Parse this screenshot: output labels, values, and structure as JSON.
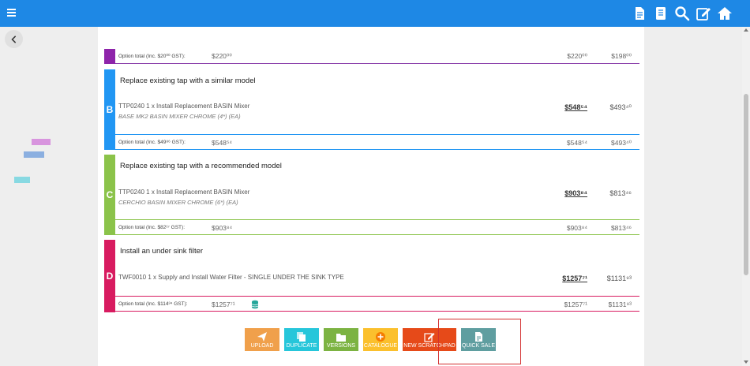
{
  "colors": {
    "topbar": "#1e88e5",
    "option_b": "#2196f3",
    "option_c": "#8bc34a",
    "option_d": "#d81b60",
    "option_prev": "#8e24aa",
    "highlight": "#d32f2f"
  },
  "topbar": {
    "icons": [
      "menu-icon",
      "document-icon",
      "notes-icon",
      "search-icon",
      "edit-icon",
      "home-icon"
    ]
  },
  "partial_row": {
    "label": "Option total (Inc. $20⁰⁰ GST):",
    "value": "$220⁰⁰",
    "price": "$220⁰⁰",
    "alt": "$198⁰⁰"
  },
  "options": [
    {
      "letter": "B",
      "title": "Replace existing tap with a similar model",
      "code": "TTP0240",
      "qty": "1",
      "desc": "x Install Replacement BASIN Mixer",
      "sub": "BASE MK2 BASIN MIXER CHROME (4*) (EA)",
      "price": "$548⁵⁴",
      "alt": "$493⁴⁰",
      "total_label": "Option total (Inc. $49⁸⁶ GST):",
      "total": "$548⁵⁴",
      "total_r1": "$548⁵⁴",
      "total_r2": "$493⁴⁰"
    },
    {
      "letter": "C",
      "title": "Replace existing tap with a recommended model",
      "code": "TTP0240",
      "qty": "1",
      "desc": "x Install Replacement BASIN Mixer",
      "sub": "CERCHIO BASIN MIXER CHROME (6*) (EA)",
      "price": "$903⁸⁴",
      "alt": "$813⁴⁶",
      "total_label": "Option total (Inc. $82¹⁷ GST):",
      "total": "$903⁸⁴",
      "total_r1": "$903⁸⁴",
      "total_r2": "$813⁴⁶"
    },
    {
      "letter": "D",
      "title": "Install an under sink filter",
      "code": "TWF0010",
      "qty": "1",
      "desc": "x Supply and Install Water Filter - SINGLE UNDER THE SINK TYPE",
      "price": "$1257⁷¹",
      "alt": "$1131⁹³",
      "total_label": "Option total (Inc. $114³⁴ GST):",
      "total": "$1257⁷¹",
      "total_r1": "$1257⁷¹",
      "total_r2": "$1131⁹³"
    }
  ],
  "actions": [
    {
      "label": "UPLOAD",
      "icon": "send-icon",
      "color": "#f0a04b"
    },
    {
      "label": "DUPLICATE",
      "icon": "duplicate-icon",
      "color": "#26c6da"
    },
    {
      "label": "VERSIONS",
      "icon": "folder-icon",
      "color": "#7cb342"
    },
    {
      "label": "CATALOGUE",
      "icon": "plus-circle-icon",
      "color": "#fbc02d"
    },
    {
      "label": "NEW SCRATCHPAD",
      "icon": "edit-icon",
      "color": "#e64a19"
    },
    {
      "label": "QUICK SALE",
      "icon": "document-icon",
      "color": "#5f9ea0"
    }
  ]
}
